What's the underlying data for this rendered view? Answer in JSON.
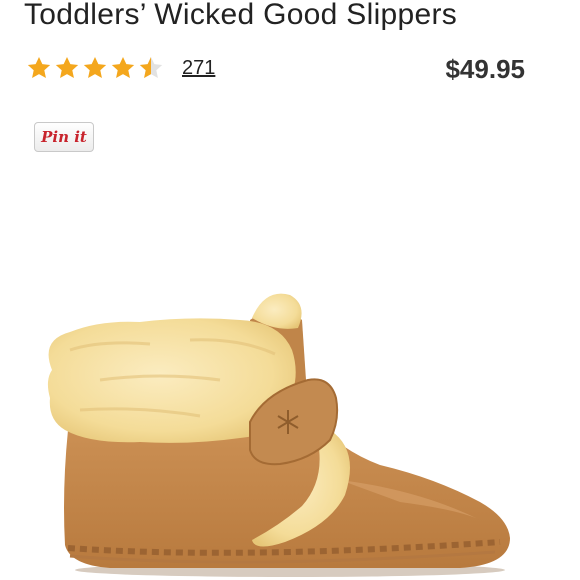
{
  "product": {
    "title": "Toddlers’ Wicked Good Slippers",
    "rating": 4.5,
    "rating_max": 5,
    "review_count": "271",
    "price": "$49.95"
  },
  "share": {
    "pin_label": "Pin it"
  },
  "colors": {
    "star": "#f4a71d",
    "star_empty": "#e2e2e2",
    "pin_red": "#c8232c",
    "suede": "#c58a4e",
    "fur": "#f7e4a8"
  },
  "image": {
    "subject_icon": "slipper-image"
  }
}
